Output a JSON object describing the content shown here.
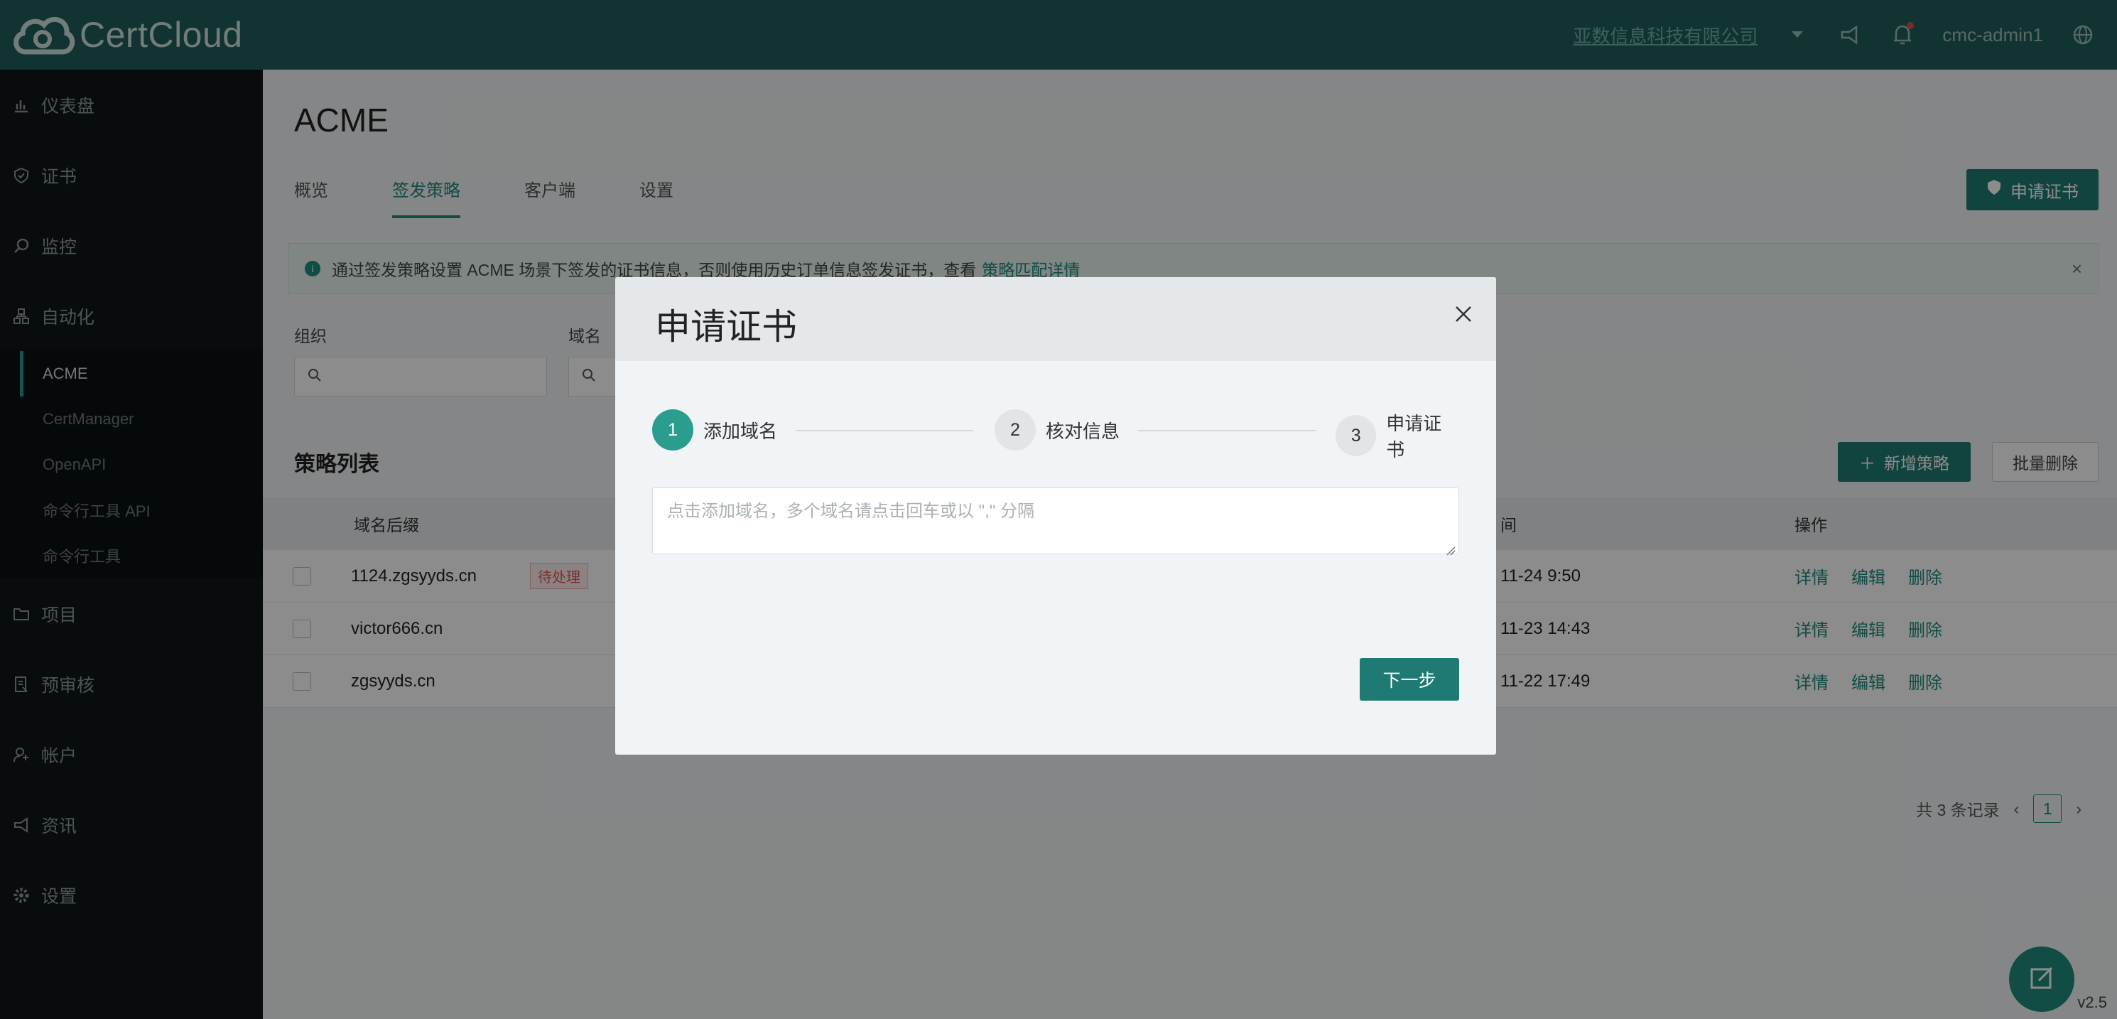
{
  "header": {
    "brand": "CertCloud",
    "org_name": "亚数信息科技有限公司",
    "user": "cmc-admin1"
  },
  "sidebar": {
    "items": [
      {
        "label": "仪表盘",
        "icon": "chart-icon"
      },
      {
        "label": "证书",
        "icon": "shield-icon"
      },
      {
        "label": "监控",
        "icon": "monitor-icon"
      },
      {
        "label": "自动化",
        "icon": "automation-icon"
      }
    ],
    "sub_items": [
      "ACME",
      "CertManager",
      "OpenAPI",
      "命令行工具 API",
      "命令行工具"
    ],
    "bottom_items": [
      {
        "label": "项目",
        "icon": "folder-icon"
      },
      {
        "label": "预审核",
        "icon": "review-icon"
      },
      {
        "label": "帐户",
        "icon": "account-icon"
      },
      {
        "label": "资讯",
        "icon": "megaphone-icon"
      },
      {
        "label": "设置",
        "icon": "gear-icon"
      }
    ]
  },
  "main": {
    "title": "ACME",
    "tabs": [
      "概览",
      "签发策略",
      "客户端",
      "设置"
    ],
    "apply_button": "申请证书",
    "alert_text": "通过签发策略设置 ACME 场景下签发的证书信息，否则使用历史订单信息签发证书，查看",
    "alert_link": "策略匹配详情",
    "filters": {
      "org_label": "组织",
      "domain_label": "域名"
    },
    "list_title": "策略列表",
    "add_button": "新增策略",
    "batch_delete_button": "批量删除",
    "table": {
      "headers": {
        "domain": "域名后缀",
        "time": "间",
        "ops": "操作"
      },
      "rows": [
        {
          "domain": "1124.zgsyyds.cn",
          "tag": "待处理",
          "time": "11-24 9:50"
        },
        {
          "domain": "victor666.cn",
          "tag": "",
          "time": "11-23 14:43"
        },
        {
          "domain": "zgsyyds.cn",
          "tag": "",
          "time": "11-22 17:49"
        }
      ],
      "ops": {
        "detail": "详情",
        "edit": "编辑",
        "delete": "删除"
      }
    },
    "pagination": {
      "total": "共 3 条记录",
      "page": "1"
    },
    "version": "v2.5"
  },
  "modal": {
    "title": "申请证书",
    "steps": [
      {
        "num": "1",
        "label": "添加域名"
      },
      {
        "num": "2",
        "label": "核对信息"
      },
      {
        "num": "3",
        "label": "申请证书"
      }
    ],
    "textarea_placeholder": "点击添加域名，多个域名请点击回车或以 \",\" 分隔",
    "next_button": "下一步"
  },
  "colors": {
    "primary": "#1f7a74",
    "header_bg": "#1f5f5b",
    "sidebar_bg": "#0f1617"
  }
}
